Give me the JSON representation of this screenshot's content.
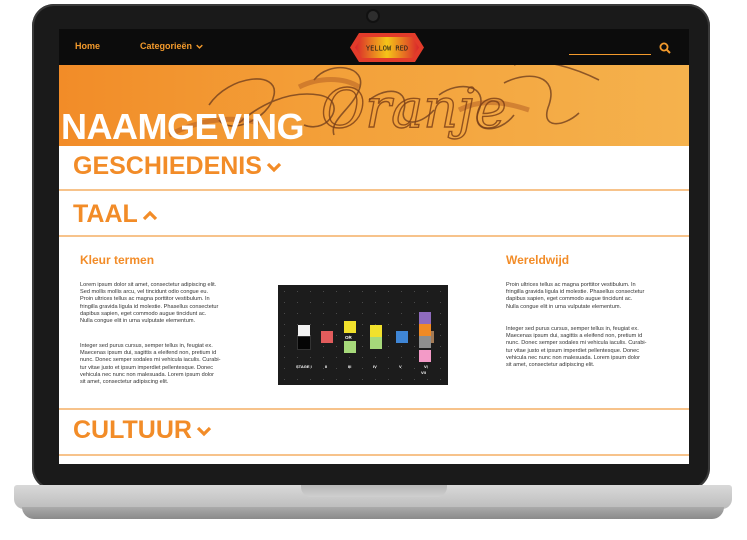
{
  "nav": {
    "home": "Home",
    "categories": "Categorieën",
    "logo_text": "YELLOW RED"
  },
  "hero": {
    "title": "NAAMGEVING",
    "script_word": "Oranje"
  },
  "sections": {
    "history": "GESCHIEDENIS",
    "language": "TAAL",
    "culture": "CULTUUR"
  },
  "left_col": {
    "heading": "Kleur termen",
    "p1": [
      "Lorem ipsum dolor sit amet, consectetur adipiscing elit.",
      "Sed mollis mollis arcu, vel tincidunt odio congue eu.",
      "Proin ultrices tellus ac magna porttitor vestibulum. In",
      "fringilla gravida ligula id molestie. Phasellus consectetur",
      "dapibus sapien, eget commodo augue tincidunt ac.",
      "Nulla congue elit in urna vulputate elementum."
    ],
    "p2": [
      "Integer sed purus cursus, semper tellus in, feugiat ex.",
      "Maecenas ipsum dui, sagittis a eleifend non, pretium id",
      "nunc. Donec semper sodales mi vehicula iaculis. Curabi-",
      "tur vitae justo et ipsum imperdiet pellentesque. Donec",
      "vehicula nec nunc non malesuada. Lorem ipsum dolor",
      "sit amet, consectetur adipiscing elit."
    ]
  },
  "right_col": {
    "heading": "Wereldwijd",
    "p1": [
      "Proin ultrices tellus ac magna porttitor vestibulum. In",
      "fringilla gravida ligula id molestie. Phasellus consectetur",
      "dapibus sapien, eget commodo augue tincidunt ac.",
      "Nulla congue elit in urna vulputate elementum."
    ],
    "p2": [
      "Integer sed purus cursus, semper tellus in, feugiat ex.",
      "Maecenas ipsum dui, sagittis a eleifend non, pretium id",
      "nunc. Donec semper sodales mi vehicula iaculis. Curabi-",
      "tur vitae justo et ipsum imperdiet pellentesque. Donec",
      "vehicula nec nunc non malesuada. Lorem ipsum dolor",
      "sit amet, consectetur adipiscing elit."
    ]
  },
  "stages_image": {
    "labels": [
      "STAGE I",
      "II",
      "III",
      "IV",
      "V",
      "VI",
      "VII"
    ],
    "or_label": "OR",
    "colors": {
      "white": "#f2f2f2",
      "black": "#050505",
      "red": "#e25c5c",
      "yellow": "#f1e12c",
      "green": "#a6d97a",
      "blue": "#3f86d6",
      "brown": "#a37a55",
      "purple": "#8f6bbd",
      "orange": "#f08a24",
      "grey": "#8e8e8e",
      "pink": "#f39ac7"
    }
  },
  "colors": {
    "accent": "#f28c28",
    "nav_bg": "#0c0c0c"
  }
}
